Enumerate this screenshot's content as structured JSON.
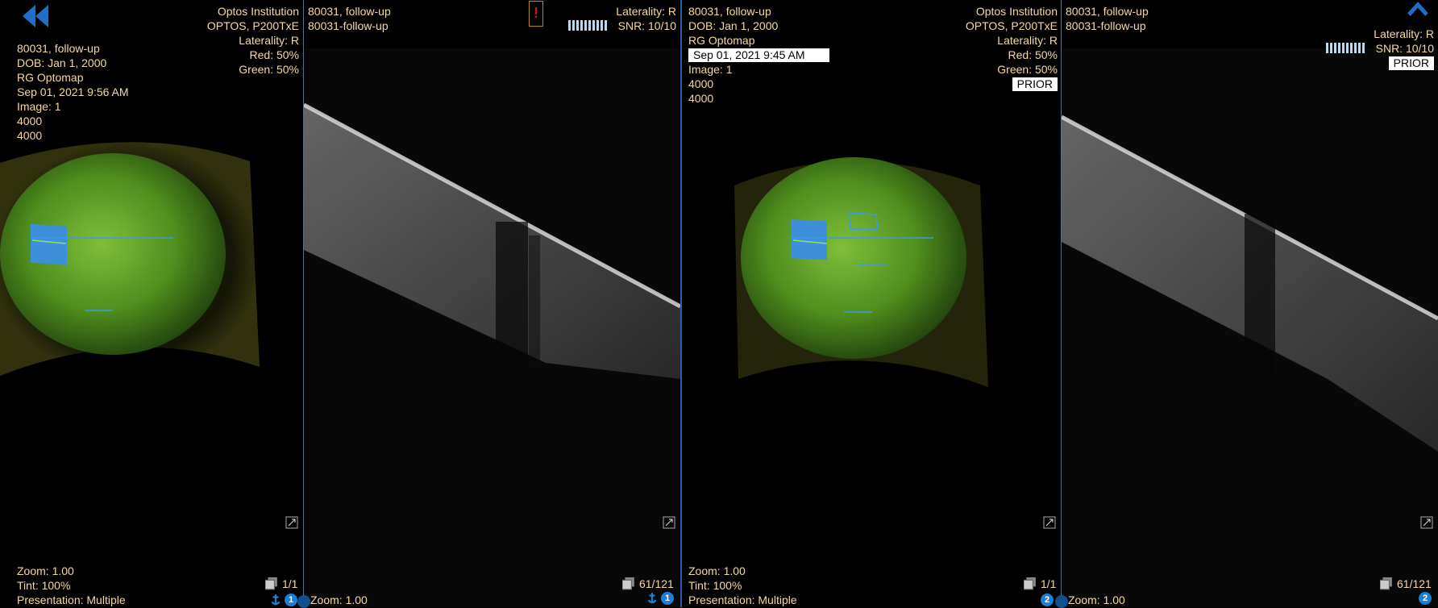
{
  "panels": [
    {
      "id": "fundus-1",
      "meta_left": [
        "80031, follow-up",
        "DOB: Jan 1, 2000",
        "RG Optomap",
        "Sep 01, 2021 9:56 AM",
        "Image: 1",
        "4000",
        "4000"
      ],
      "meta_right": [
        "Optos Institution",
        "OPTOS, P200TxE",
        "Laterality: R",
        "Red: 50%",
        "Green: 50%"
      ],
      "footer": [
        "Zoom: 1.00",
        "Tint: 100%",
        "Presentation: Multiple"
      ],
      "counter": "1/1",
      "viewport_number": "1"
    },
    {
      "id": "oct-1",
      "meta_left": [
        "80031, follow-up",
        "80031-follow-up"
      ],
      "meta_right": [
        "Laterality: R",
        "SNR: 10/10"
      ],
      "footer": [
        "Zoom: 1.00"
      ],
      "counter": "61/121",
      "viewport_number": "1",
      "warning": "!"
    },
    {
      "id": "fundus-2",
      "meta_left": [
        "80031, follow-up",
        "DOB: Jan 1, 2000",
        "RG Optomap",
        "Sep 01, 2021 9:45 AM",
        "Image: 1",
        "4000",
        "4000"
      ],
      "meta_right": [
        "Optos Institution",
        "OPTOS, P200TxE",
        "Laterality: R",
        "Red: 50%",
        "Green: 50%",
        "PRIOR"
      ],
      "footer": [
        "Zoom: 1.00",
        "Tint: 100%",
        "Presentation: Multiple"
      ],
      "counter": "1/1",
      "viewport_number": "2"
    },
    {
      "id": "oct-2",
      "meta_left": [
        "80031, follow-up",
        "80031-follow-up"
      ],
      "meta_right": [
        "Laterality: R",
        "SNR: 10/10",
        "PRIOR"
      ],
      "footer": [
        "Zoom: 1.00"
      ],
      "counter": "61/121",
      "viewport_number": "2"
    }
  ],
  "colors": {
    "overlay_text": "#f3d9a4",
    "accent_blue": "#1d7fd4",
    "fundus_green": "#5fa322",
    "snr_bar": "#b9d9ee"
  },
  "icons": {
    "back": "double-chevron-left-icon",
    "collapse": "chevron-up-icon",
    "expand": "expand-icon",
    "stack": "image-stack-icon",
    "anchor": "anchor-icon"
  },
  "snr": {
    "score": 10,
    "max": 10
  }
}
